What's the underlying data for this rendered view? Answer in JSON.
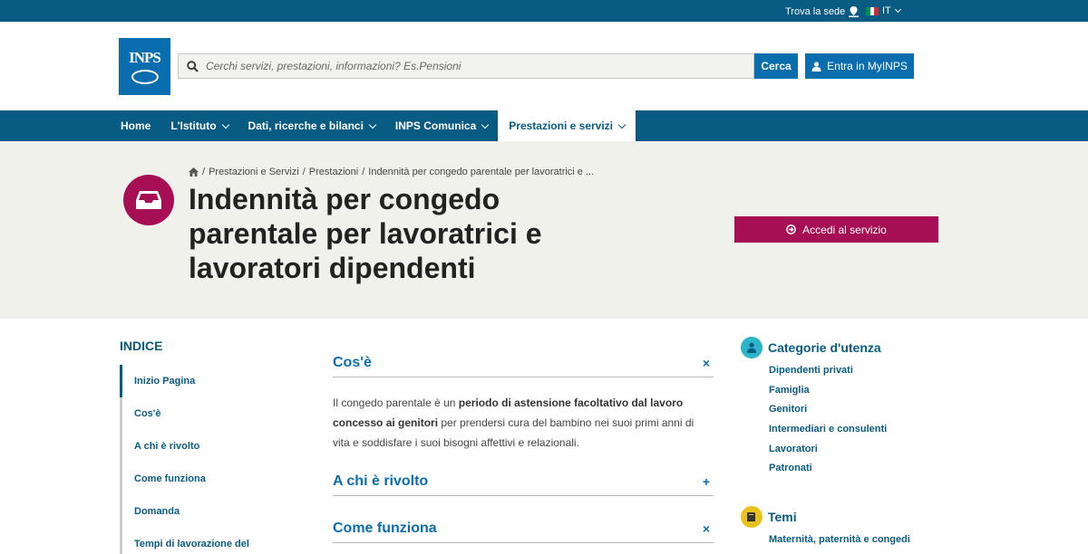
{
  "topbar": {
    "find_office": "Trova la sede",
    "language": "IT",
    "flag_colors": [
      "#009246",
      "#ffffff",
      "#ce2b37"
    ]
  },
  "header": {
    "logo_text": "INPS",
    "search_placeholder": "Cerchi servizi, prestazioni, informazioni? Es.Pensioni",
    "search_button": "Cerca",
    "login_button": "Entra in MyINPS"
  },
  "nav": {
    "items": [
      {
        "label": "Home"
      },
      {
        "label": "L'Istituto"
      },
      {
        "label": "Dati, ricerche e bilanci"
      },
      {
        "label": "INPS Comunica"
      },
      {
        "label": "Prestazioni e servizi"
      }
    ]
  },
  "breadcrumb": {
    "items": [
      "Prestazioni e Servizi",
      "Prestazioni",
      "Indennità per congedo parentale per lavoratrici e ..."
    ],
    "separator": "/"
  },
  "hero": {
    "title": "Indennità per congedo parentale per lavoratrici e lavoratori dipendenti",
    "cta": "Accedi al servizio"
  },
  "index": {
    "title": "INDICE",
    "items": [
      "Inizio Pagina",
      "Cos'è",
      "A chi è rivolto",
      "Come funziona",
      "Domanda",
      "Tempi di lavorazione del"
    ]
  },
  "accordion": {
    "sections": [
      {
        "title": "Cos'è",
        "toggle": "×"
      },
      {
        "title": "A chi è rivolto",
        "toggle": "+"
      },
      {
        "title": "Come funziona",
        "toggle": "×"
      }
    ],
    "body": {
      "p1": "Il congedo parentale è un ",
      "b1": "periodo di astensione facoltativo dal lavoro concesso ai genitori",
      "p2": " per prendersi cura del bambino nei suoi primi anni di vita e soddisfare i suoi bisogni affettivi e relazionali."
    }
  },
  "sidebar": {
    "categories": {
      "title": "Categorie d'utenza",
      "items": [
        "Dipendenti privati",
        "Famiglia",
        "Genitori",
        "Intermediari e consulenti",
        "Lavoratori",
        "Patronati"
      ]
    },
    "themes": {
      "title": "Temi",
      "items": [
        "Maternità, paternità e congedi"
      ]
    }
  },
  "colors": {
    "primary_blue": "#085b82",
    "accent_blue": "#0a6eae",
    "magenta": "#a70f55",
    "teal": "#2cb5c8",
    "yellow": "#e8c11a"
  }
}
